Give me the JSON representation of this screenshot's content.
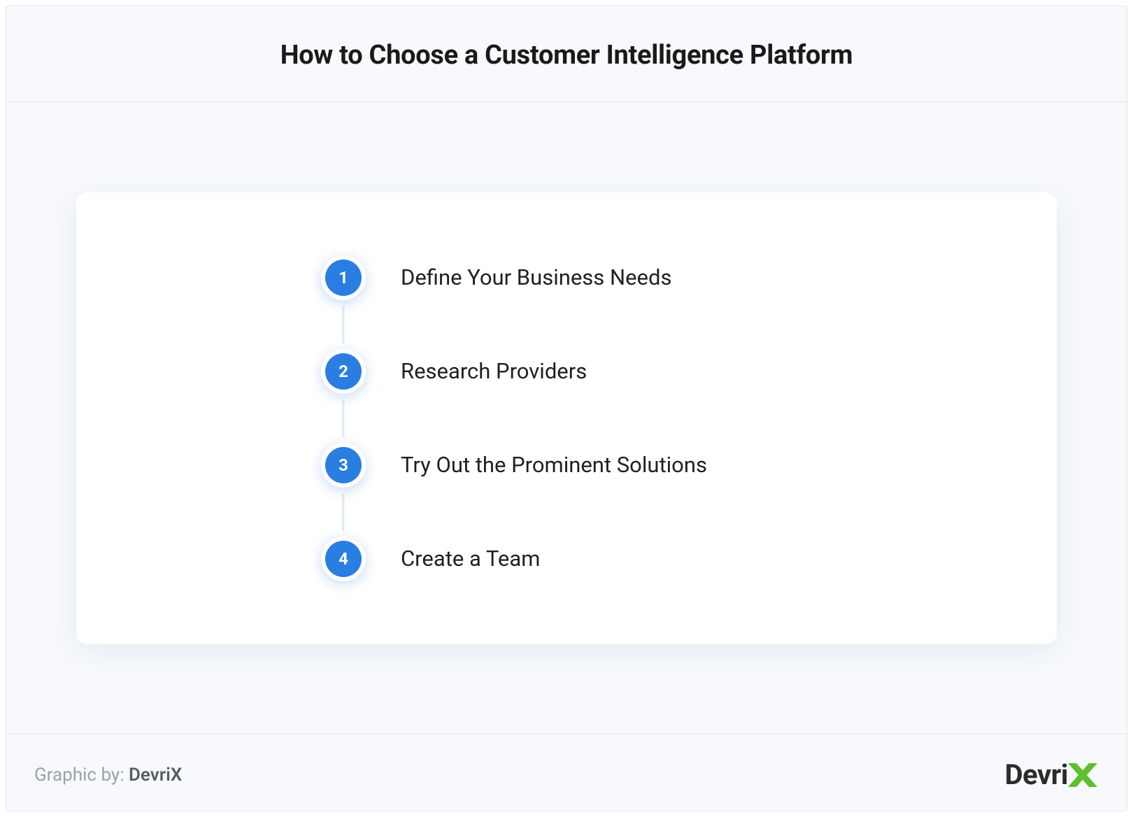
{
  "title": "How to Choose a Customer Intelligence Platform",
  "steps": [
    {
      "num": "1",
      "label": "Define Your Business Needs"
    },
    {
      "num": "2",
      "label": "Research Providers"
    },
    {
      "num": "3",
      "label": "Try Out the Prominent Solutions"
    },
    {
      "num": "4",
      "label": "Create a Team"
    }
  ],
  "footer": {
    "credit_prefix": "Graphic by: ",
    "credit_brand": "DevriX"
  },
  "logo": {
    "text": "Devri"
  },
  "colors": {
    "accent": "#2a7de1",
    "logo_x": "#5fbf2e"
  }
}
